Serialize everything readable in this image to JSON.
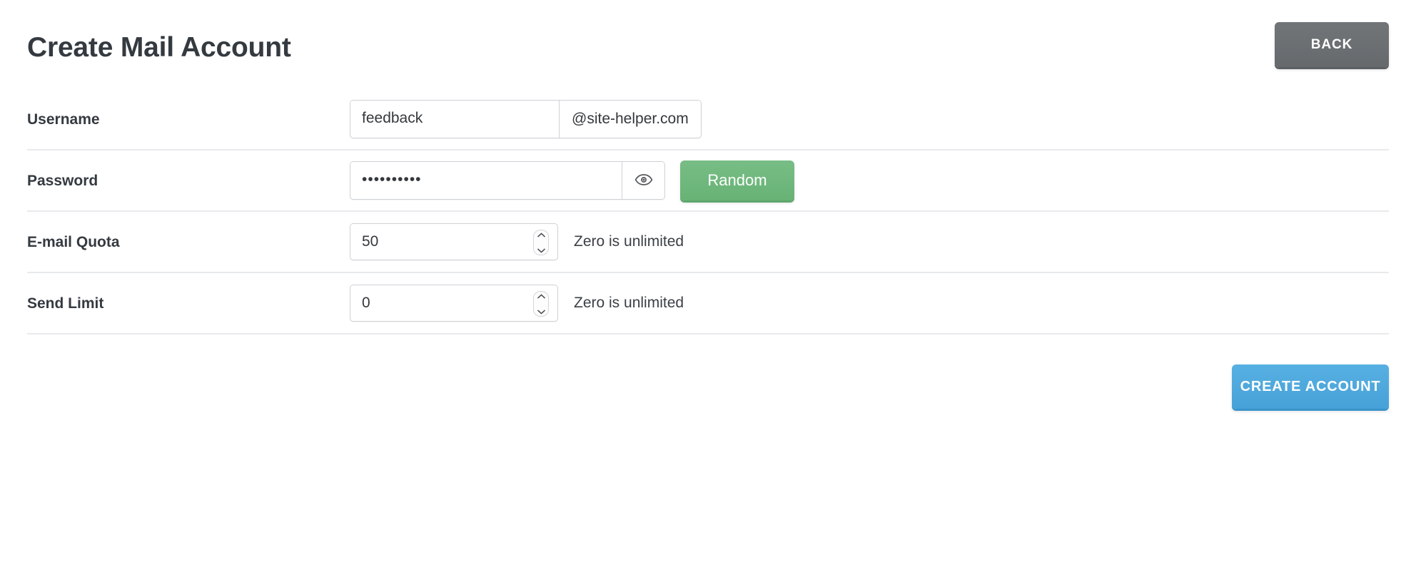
{
  "header": {
    "title": "Create Mail Account",
    "back_label": "BACK"
  },
  "form": {
    "rows": [
      {
        "label": "Username",
        "value": "feedback",
        "suffix": "@site-helper.com"
      },
      {
        "label": "Password",
        "value": "••••••••••",
        "random_label": "Random",
        "eye_icon": "eye-icon"
      },
      {
        "label": "E-mail Quota",
        "value": "50",
        "hint": "Zero is unlimited"
      },
      {
        "label": "Send Limit",
        "value": "0",
        "hint": "Zero is unlimited"
      }
    ]
  },
  "footer": {
    "create_label": "CREATE ACCOUNT"
  },
  "colors": {
    "back_button": "#6b6f72",
    "random_button": "#6fb87d",
    "create_button": "#4fa8dc",
    "title_text": "#343a40",
    "separator": "#e8eaec",
    "input_border": "#ced1d4",
    "page_background": "#ffffff"
  }
}
